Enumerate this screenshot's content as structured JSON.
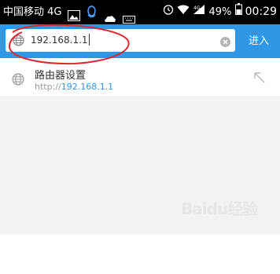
{
  "status_bar": {
    "carrier": "中国移动",
    "network": "4G",
    "signal_bars": "4G",
    "battery": "49%",
    "time": "00:29",
    "icons": [
      "image-icon",
      "qq-icon",
      "upload-icon",
      "keyboard-icon",
      "alarm-icon",
      "wifi-icon",
      "signal-icon",
      "battery-icon"
    ]
  },
  "address_bar": {
    "value": "192.168.1.1",
    "go_label": "进入"
  },
  "suggestions": [
    {
      "title": "路由器设置",
      "scheme": "http://",
      "host": "192.168.1.1"
    }
  ],
  "watermark": "Baidu经验",
  "colors": {
    "toolbar": "#2f97e6",
    "annotation_circle": "#e0242e",
    "link": "#2f97e6"
  }
}
